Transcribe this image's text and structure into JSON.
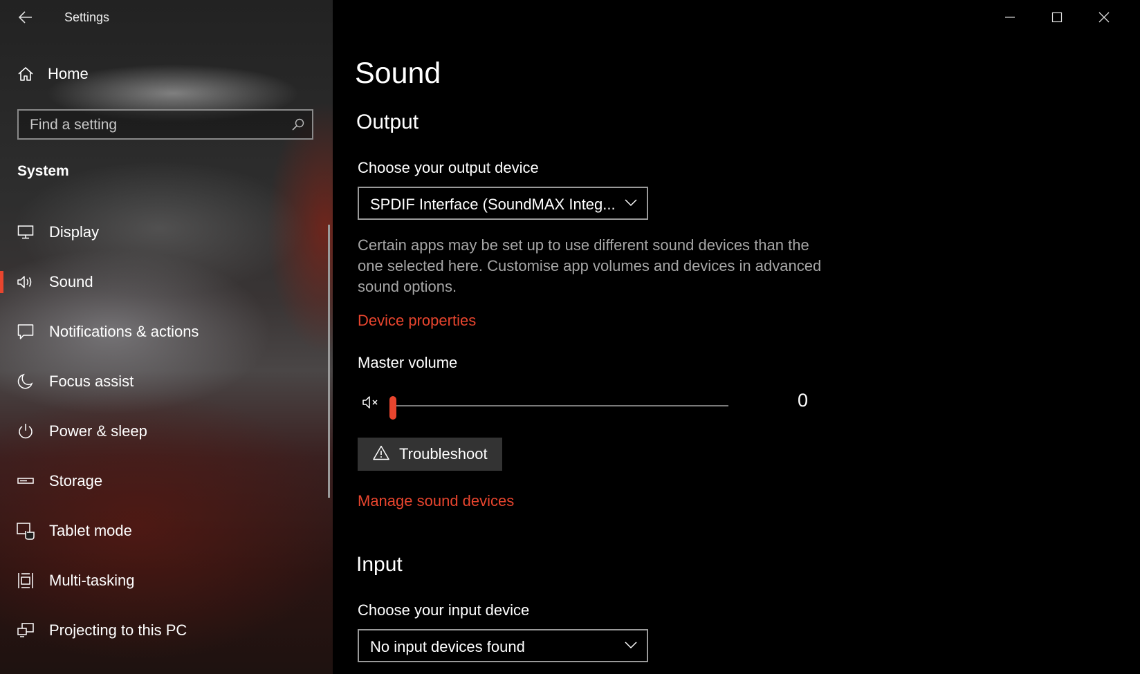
{
  "window": {
    "title": "Settings",
    "controls": [
      "minimize",
      "maximize",
      "close"
    ]
  },
  "sidebar": {
    "home_label": "Home",
    "search": {
      "placeholder": "Find a setting"
    },
    "section_title": "System",
    "items": [
      {
        "label": "Display",
        "icon": "monitor-icon",
        "active": false
      },
      {
        "label": "Sound",
        "icon": "speaker-icon",
        "active": true
      },
      {
        "label": "Notifications & actions",
        "icon": "message-icon",
        "active": false
      },
      {
        "label": "Focus assist",
        "icon": "moon-icon",
        "active": false
      },
      {
        "label": "Power & sleep",
        "icon": "power-icon",
        "active": false
      },
      {
        "label": "Storage",
        "icon": "drive-icon",
        "active": false
      },
      {
        "label": "Tablet mode",
        "icon": "tablet-mode-icon",
        "active": false
      },
      {
        "label": "Multi-tasking",
        "icon": "multitasking-icon",
        "active": false
      },
      {
        "label": "Projecting to this PC",
        "icon": "projecting-icon",
        "active": false
      }
    ]
  },
  "main": {
    "page_title": "Sound",
    "output": {
      "heading": "Output",
      "choose_label": "Choose your output device",
      "device_value": "SPDIF Interface (SoundMAX Integ...",
      "description": "Certain apps may be set up to use different sound devices than the one selected here. Customise app volumes and devices in advanced sound options.",
      "device_properties_link": "Device properties",
      "master_volume_label": "Master volume",
      "volume_value": "0",
      "volume_level": 0,
      "troubleshoot_label": "Troubleshoot",
      "manage_link": "Manage sound devices"
    },
    "input": {
      "heading": "Input",
      "choose_label": "Choose your input device",
      "device_value": "No input devices found"
    }
  },
  "colors": {
    "accent": "#e8452e",
    "background": "#000000",
    "secondary_text": "#a6a6a6",
    "button_bg": "#333333"
  }
}
